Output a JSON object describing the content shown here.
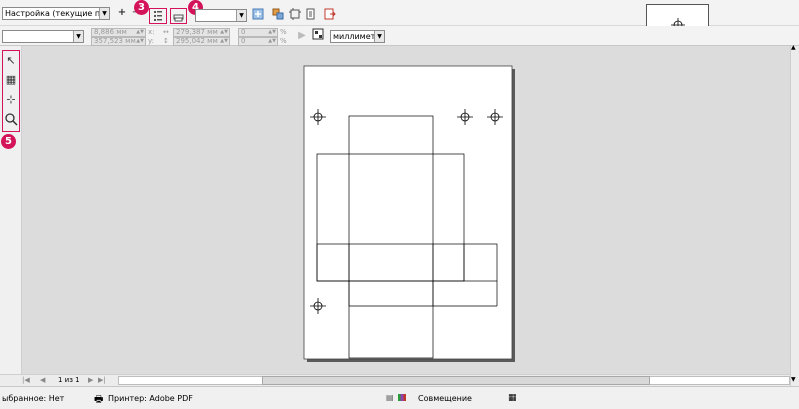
{
  "toolbar": {
    "preset_value": "Настройка (текущие парам...",
    "add_symbol": "+",
    "minus_symbol": "−",
    "badge3": "3",
    "badge4": "4",
    "printer_combo_value": ""
  },
  "propbar": {
    "x_value": "8,886 мм",
    "y_value": "357,523 мм",
    "x_label": "x:",
    "y_label": "y:",
    "w_value": "279,387 мм",
    "h_value": "295,042 мм",
    "sx_value": "0",
    "sy_value": "0",
    "pct1": "%",
    "pct2": "%",
    "units_value": "миллимет..."
  },
  "toolbox": {
    "badge5": "5"
  },
  "pagebar": {
    "page_label": "1 из 1"
  },
  "status": {
    "selected": "ыбранное: Нет",
    "printer": "Принтер: Adobe PDF",
    "match": "Совмещение"
  },
  "colors": {
    "highlight": "#d4145a",
    "canvas": "#dcdcdc"
  }
}
